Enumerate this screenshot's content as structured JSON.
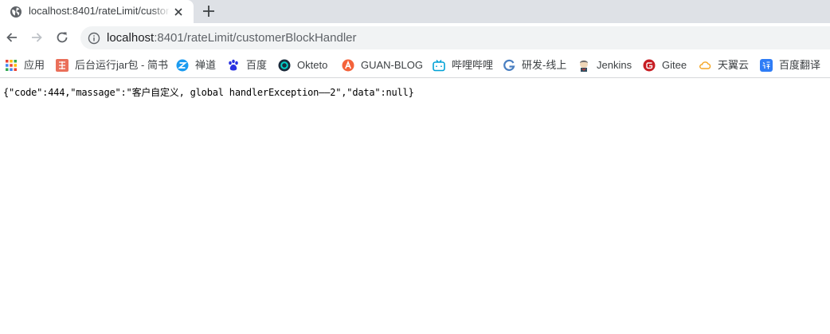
{
  "tab": {
    "title": "localhost:8401/rateLimit/customerBlockHandler",
    "favicon": "globe-icon",
    "close_icon": "close-icon",
    "new_tab_icon": "plus-icon"
  },
  "toolbar": {
    "back_icon": "arrow-left-icon",
    "forward_icon": "arrow-right-icon",
    "reload_icon": "reload-icon",
    "info_icon": "info-icon",
    "url_host": "localhost",
    "url_path": ":8401/rateLimit/customerBlockHandler"
  },
  "bookmarks": [
    {
      "label": "应用",
      "icon": "apps-grid-icon",
      "color": "#ea4335"
    },
    {
      "label": "后台运行jar包 - 简书",
      "icon": "jianshu-icon",
      "color": "#ea6f5a"
    },
    {
      "label": "禅道",
      "icon": "zentao-icon",
      "color": "#1a9bf0"
    },
    {
      "label": "百度",
      "icon": "baidu-paw-icon",
      "color": "#2932e1"
    },
    {
      "label": "Okteto",
      "icon": "okteto-icon",
      "color": "#1a2b3c"
    },
    {
      "label": "GUAN-BLOG",
      "icon": "guan-blog-icon",
      "color": "#f4623a"
    },
    {
      "label": "哔哩哔哩",
      "icon": "bilibili-icon",
      "color": "#00a1d6"
    },
    {
      "label": "研发-线上",
      "icon": "dev-online-icon",
      "color": "#4a7fc1"
    },
    {
      "label": "Jenkins",
      "icon": "jenkins-icon",
      "color": "#d33833"
    },
    {
      "label": "Gitee",
      "icon": "gitee-icon",
      "color": "#c71d23"
    },
    {
      "label": "天翼云",
      "icon": "tianyi-cloud-icon",
      "color": "#f5a623"
    },
    {
      "label": "百度翻译",
      "icon": "baidu-translate-icon",
      "color": "#2e7cf6"
    }
  ],
  "page": {
    "body_text": "{\"code\":444,\"massage\":\"客户自定义, global handlerException——2\",\"data\":null}"
  }
}
